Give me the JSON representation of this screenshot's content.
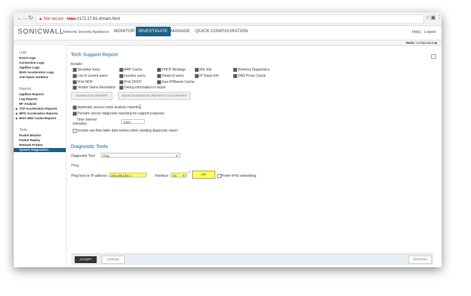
{
  "browser": {
    "not_secure": "Not secure",
    "protocol": "https",
    "url": "://172.27.61.4/main.html"
  },
  "header": {
    "logo": "SONICWALL",
    "app_name": "Network Security Appliance",
    "nav": [
      "MONITOR",
      "INVESTIGATE",
      "MANAGE",
      "QUICK CONFIGURATION"
    ],
    "active_nav": "INVESTIGATE",
    "help": "Help",
    "separator": "|",
    "logout": "Logout",
    "mode_label": "Mode:",
    "mode_value": "Configuration ▶"
  },
  "sidebar": {
    "logs_head": "Logs",
    "logs": [
      "Event Logs",
      "Connection Logs",
      "Appflow Logs",
      "WAN Acceleration Logs",
      "Anti-Spam Junkbox"
    ],
    "reports_head": "Reports",
    "reports": [
      "Appflow Reports",
      "Log Reports",
      "RF Analysis",
      "TCP Acceleration Reports",
      "WFS Acceleration Reports",
      "WXA Web Cache Reports"
    ],
    "tools_head": "Tools",
    "tools": [
      "Packet Monitor",
      "Packet Replay",
      "Network Probes",
      "System Diagnostics"
    ],
    "active_item": "System Diagnostics"
  },
  "tech_support": {
    "title": "Tech Support Report",
    "include_label": "Include:",
    "options": [
      [
        "Sensitive Keys",
        "ARP Cache",
        "DHCP Bindings",
        "IKE Info",
        "Wireless Diagnostics"
      ],
      [
        "List of current users",
        "Inactive users",
        "Detail of users",
        "IP Stack Info",
        "DNS Proxy Cache"
      ],
      [
        "IPv6 NDP",
        "IPv6 DHCP",
        "Geo-IP/Botnet Cache"
      ],
      [
        "Vendor Name Resolution",
        "Debug information in report"
      ]
    ],
    "download_button": "DOWNLOAD REPORT",
    "send_button": "SEND DIAGNOSTIC REPORTS TO SUPPORT",
    "auto_crash": "Automatic secure crash analysis reporting",
    "asterisk": "*",
    "periodic": "Periodic secure diagnostic reporting for support purposes",
    "time_interval_label": "Time Interval",
    "time_interval_unit": "(minutes)",
    "time_interval_value": "1440",
    "raw_flow": "Include raw flow table data entries when sending diagnostic report"
  },
  "diag_tools": {
    "title": "Diagnostic Tools",
    "tool_label": "Diagnostic Tool:",
    "tool_value": "Ping",
    "section": "Ping",
    "host_label": "Ping host or IP address:",
    "host_value": "204.180.153.1",
    "interface_label": "Interface:",
    "interface_value": "X1",
    "interface_asterisk": "*",
    "go_button": "GO",
    "prefer_ipv6": "Prefer IPv6 networking"
  },
  "footer": {
    "accept": "ACCEPT",
    "cancel": "CANCEL",
    "refresh": "REFRESH"
  },
  "colors": {
    "accent": "#1e5f86",
    "highlight": "#ffff55",
    "accept_bg": "#333333"
  }
}
